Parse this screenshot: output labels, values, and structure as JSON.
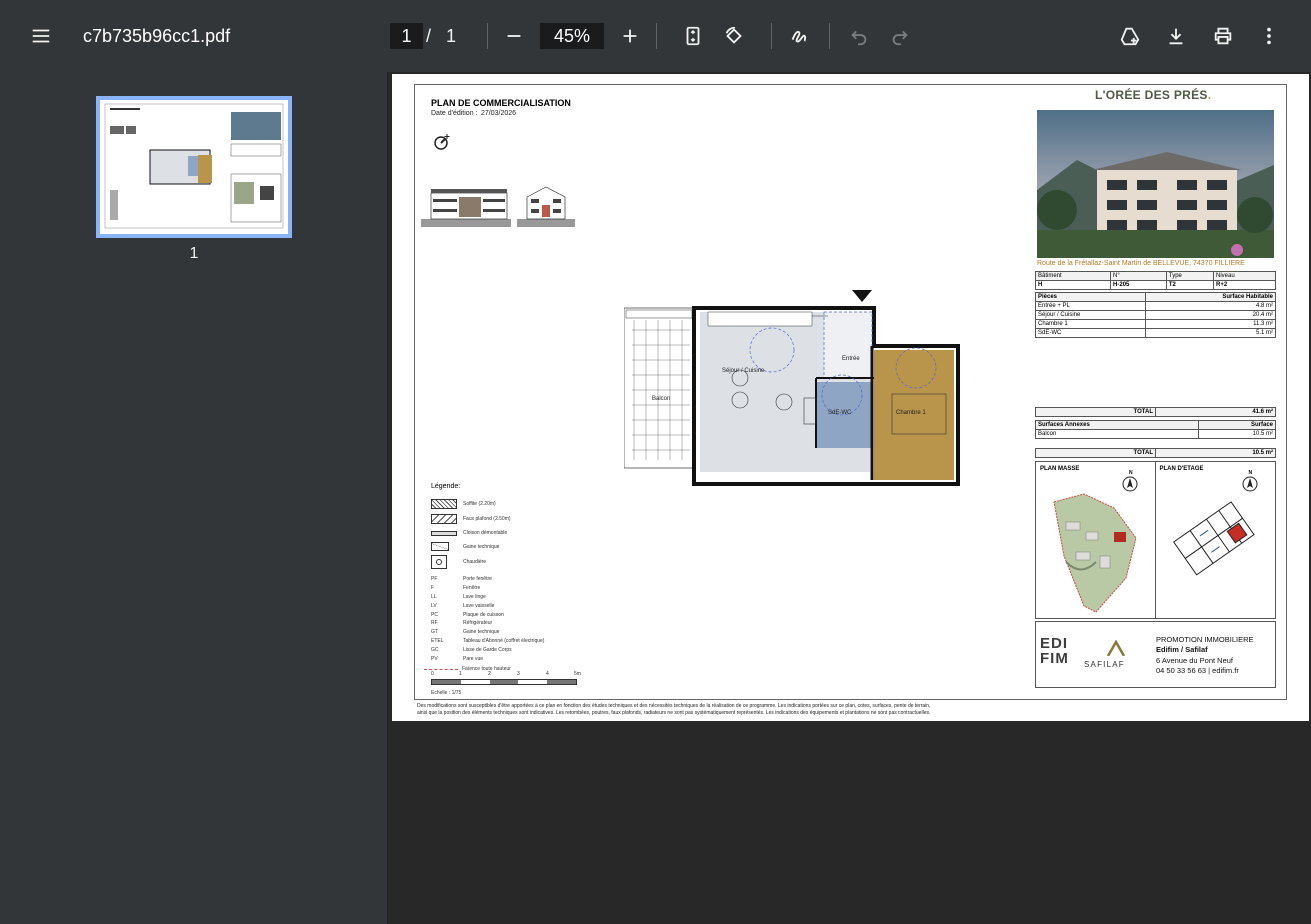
{
  "toolbar": {
    "file_name": "c7b735b96cc1.pdf",
    "current_page": "1",
    "page_separator": "/",
    "total_pages": "1",
    "zoom": "45%"
  },
  "sidebar": {
    "thumbnail_label": "1"
  },
  "document": {
    "title": "PLAN DE COMMERCIALISATION",
    "edition_label": "Date d'édition :",
    "edition_date": "27/03/2026",
    "brand": "L'ORÉE DES PRÉS",
    "brand_dot": ".",
    "address": "Route de la Frétallaz-Saint Martin de BELLEVUE, 74370 FILLIERE",
    "lot_headers": [
      "Bâtiment",
      "N°",
      "Type",
      "Niveau"
    ],
    "lot_values": [
      "H",
      "H-205",
      "T2",
      "R+2"
    ],
    "rooms_header": [
      "Pièces",
      "Surface Habitable"
    ],
    "rooms": [
      {
        "name": "Entrée + PL",
        "area": "4.8 m²"
      },
      {
        "name": "Séjour / Cuisine",
        "area": "20.4 m²"
      },
      {
        "name": "Chambre 1",
        "area": "11.3 m²"
      },
      {
        "name": "SdE-WC",
        "area": "5.1 m²"
      }
    ],
    "total_label": "TOTAL",
    "total_area": "41.6 m²",
    "annex_header": [
      "Surfaces Annexes",
      "Surface"
    ],
    "annex": [
      {
        "name": "Balcon",
        "area": "10.5 m²"
      }
    ],
    "annex_total": "10.5 m²",
    "plan_masse": "PLAN MASSE",
    "plan_etage": "PLAN D'ETAGE",
    "north": "N",
    "promo_title": "PROMOTION IMMOBILIERE",
    "promo_company": "Edifim / Safilaf",
    "promo_address": "6 Avenue du Pont Neuf",
    "promo_contact": "04 50 33 56 63 | edifim.fr",
    "logo_edifim": "EDI FIM",
    "logo_safilaf": "SAFILAF",
    "legend_title": "Légende:",
    "legend_items": [
      "Soffite (2.20m)",
      "Faux plafond (2.50m)",
      "Cloison démontable",
      "Gaine technique",
      "Chaudière"
    ],
    "abbreviations": [
      {
        "k": "PF",
        "v": "Porte fenêtre"
      },
      {
        "k": "F",
        "v": "Fenêtre"
      },
      {
        "k": "LL",
        "v": "Lave linge"
      },
      {
        "k": "LV",
        "v": "Lave vaisselle"
      },
      {
        "k": "PC",
        "v": "Plaque de cuisson"
      },
      {
        "k": "RF",
        "v": "Réfrigérateur"
      },
      {
        "k": "GT",
        "v": "Gaine technique"
      },
      {
        "k": "ETEL",
        "v": "Tableau d'Abonné (coffret électrique)"
      },
      {
        "k": "GC",
        "v": "Lisse de Garde Corps"
      },
      {
        "k": "PV",
        "v": "Pare vue"
      },
      {
        "k": "",
        "v": "Faïence toute hauteur"
      }
    ],
    "scale_ticks": [
      "0",
      "1",
      "2",
      "3",
      "4",
      "5m"
    ],
    "scale_label": "Echelle : 1/75",
    "plan_labels": {
      "balcon": "Balcon",
      "sejour": "Séjour / Cuisine",
      "entree": "Entrée",
      "sde": "SdE-WC",
      "chambre": "Chambre 1"
    },
    "disclaimer_1": "Des modifications sont susceptibles d'être apportées à ce plan en fonction des études techniques et des nécessités techniques de la réalisation de ce programme.  Les indications portées sur ce plan, cotes, surfaces, pente de terrain,",
    "disclaimer_2": "ainsi que la position des éléments techniques sont indicatives.  Les retombées, poutres, faux plafonds, radiateurs ne sont pas systématiquement représentés. Les indications des équipements et plantations ne sont pas contractuelles."
  }
}
